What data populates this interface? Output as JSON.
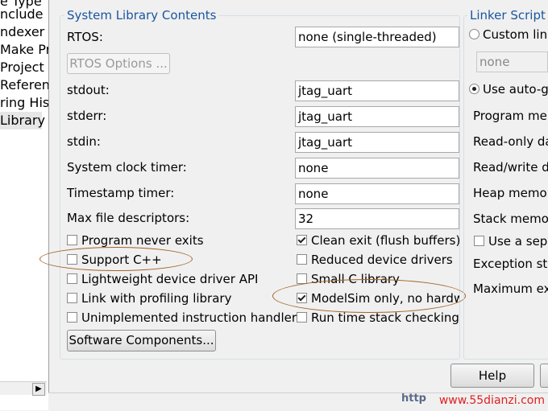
{
  "tree": {
    "items": [
      {
        "label": "e Type"
      },
      {
        "label": "nclude P"
      },
      {
        "label": "ndexer"
      },
      {
        "label": "Make Pro"
      },
      {
        "label": "Project P"
      },
      {
        "label": "Referenc"
      },
      {
        "label": "ring Hist"
      },
      {
        "label": "Library"
      }
    ]
  },
  "system_library": {
    "title": "System Library Contents",
    "rtos_label": "RTOS:",
    "rtos_value": "none (single-threaded)",
    "rtos_options_button": "RTOS Options ...",
    "stdout_label": "stdout:",
    "stdout_value": "jtag_uart",
    "stderr_label": "stderr:",
    "stderr_value": "jtag_uart",
    "stdin_label": "stdin:",
    "stdin_value": "jtag_uart",
    "sysclk_label": "System clock timer:",
    "sysclk_value": "none",
    "timestamp_label": "Timestamp timer:",
    "timestamp_value": "none",
    "maxfd_label": "Max file descriptors:",
    "maxfd_value": "32",
    "checkboxes_left": [
      {
        "label": "Program never exits",
        "checked": false
      },
      {
        "label": "Support C++",
        "checked": false
      },
      {
        "label": "Lightweight device driver API",
        "checked": false
      },
      {
        "label": "Link with profiling library",
        "checked": false
      },
      {
        "label": "Unimplemented instruction handler",
        "checked": false
      }
    ],
    "checkboxes_right": [
      {
        "label": "Clean exit (flush buffers)",
        "checked": true
      },
      {
        "label": "Reduced device drivers",
        "checked": false
      },
      {
        "label": "Small C library",
        "checked": false
      },
      {
        "label": "ModelSim only, no hardw",
        "checked": true
      },
      {
        "label": "Run time stack checking",
        "checked": false
      }
    ],
    "software_components_button": "Software Components..."
  },
  "linker_script": {
    "title": "Linker Script",
    "custom_radio": "Custom link",
    "custom_value": "none",
    "auto_radio": "Use auto-g",
    "rows": [
      "Program mem",
      "Read-only da",
      "Read/write d",
      "Heap memor",
      "Stack memor"
    ],
    "separate_checkbox": "Use a sepa",
    "exception_label": "Exception sta",
    "maximum_label": "Maximum ex"
  },
  "footer": {
    "help_button": "Help",
    "url_fragment": "http",
    "watermark": "www.55dianzi.com"
  }
}
